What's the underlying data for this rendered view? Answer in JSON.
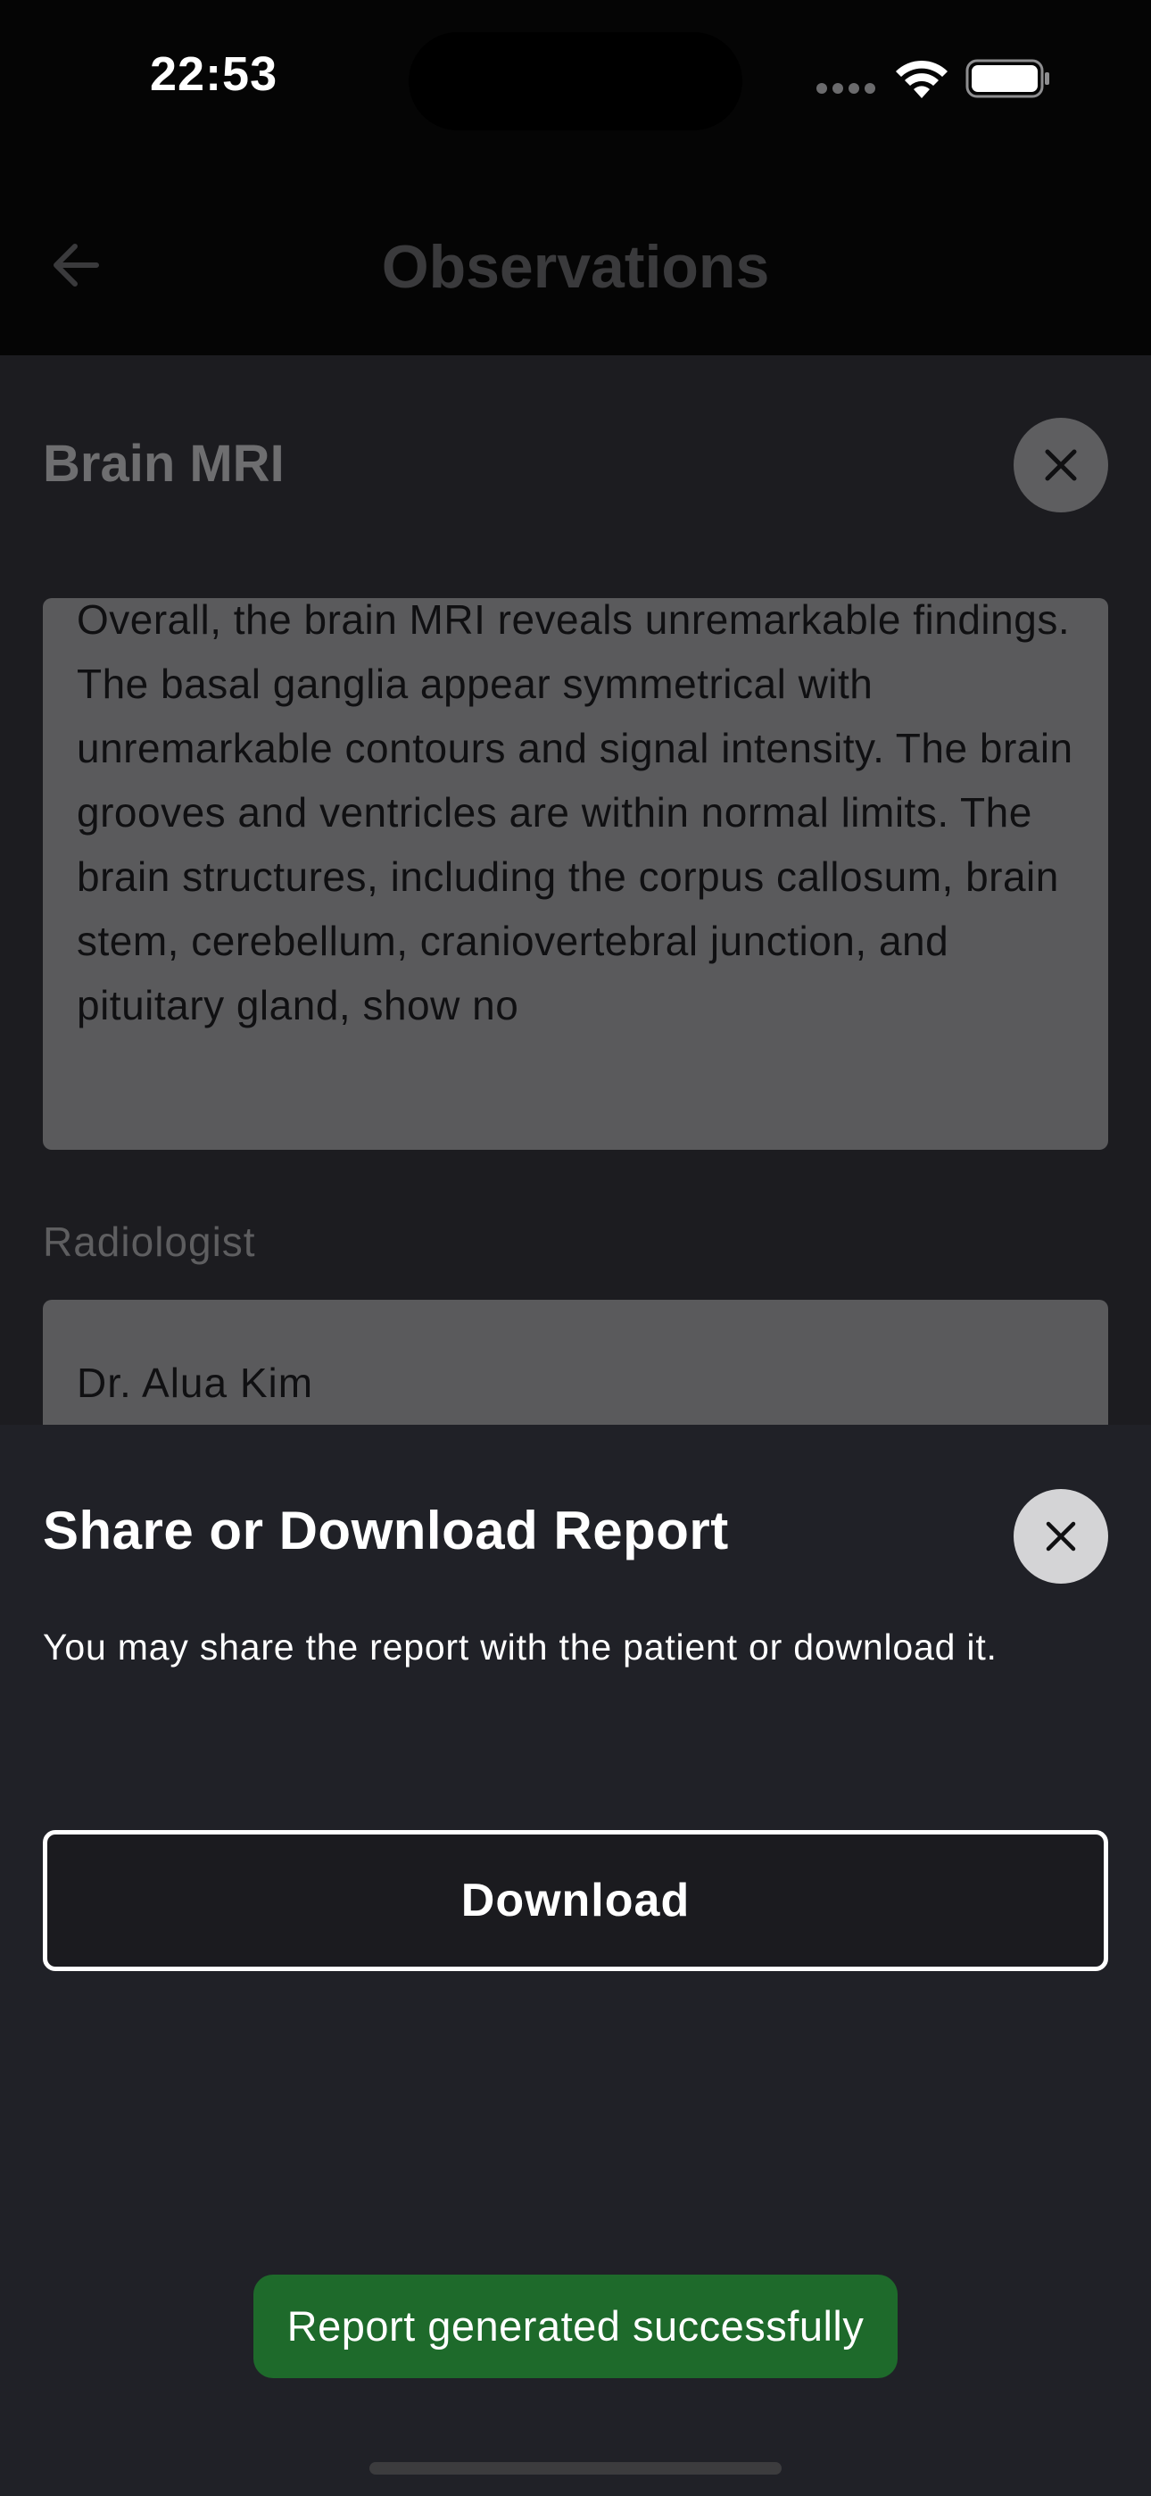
{
  "status_bar": {
    "time": "22:53"
  },
  "header": {
    "title": "Observations",
    "back_icon": "arrow-left-icon"
  },
  "observation": {
    "title": "Brain MRI",
    "findings": "Overall, the brain MRI reveals unremarkable findings. The basal ganglia appear symmetrical with unremarkable contours and signal intensity. The brain grooves and ventricles are within normal limits. The brain structures, including the corpus callosum, brain stem, cerebellum, craniovertebral junction, and pituitary gland, show no",
    "radiologist_label": "Radiologist",
    "radiologist_value": "Dr. Alua Kim"
  },
  "sheet": {
    "title": "Share or Download Report",
    "description": "You may share the report with the patient or download it.",
    "download_label": "Download",
    "close_icon": "close-icon"
  },
  "toast": {
    "message": "Report generated successfully",
    "color": "#1e6a2b"
  }
}
